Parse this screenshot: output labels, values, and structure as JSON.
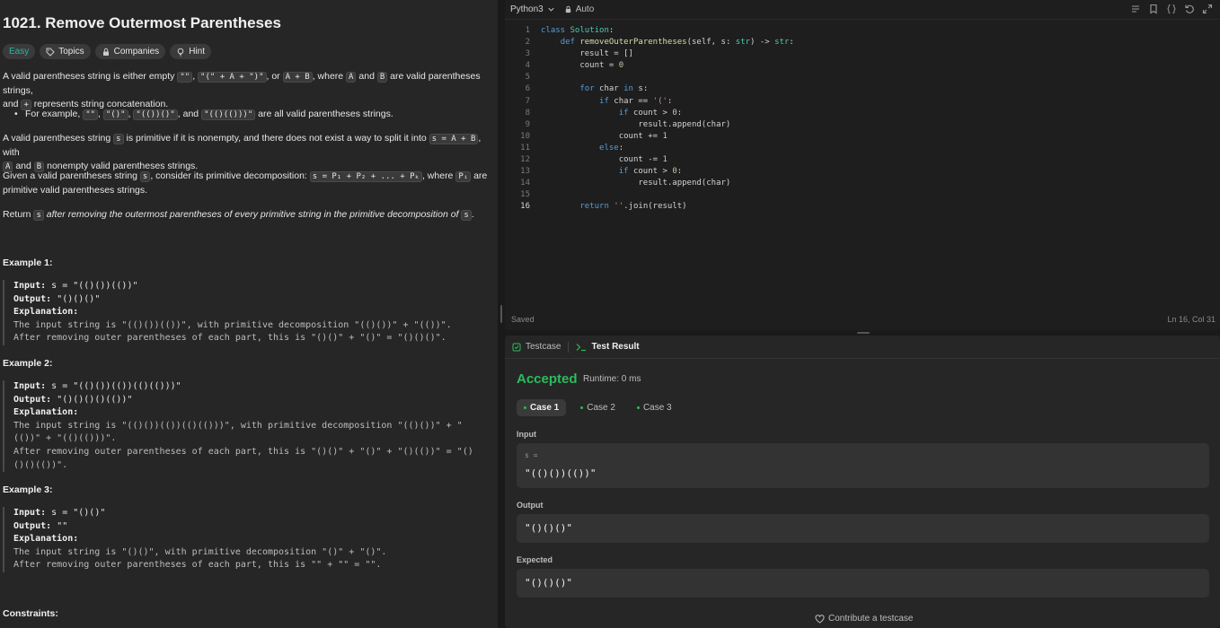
{
  "problem": {
    "title": "1021. Remove Outermost Parentheses",
    "difficulty": "Easy",
    "chips": [
      "Topics",
      "Companies",
      "Hint"
    ],
    "p1": {
      "t1": "A valid parentheses string is either empty ",
      "c1": "\"\"",
      "t2": ", ",
      "c2": "\"(\" + A + \")\"",
      "t3": ", or ",
      "c3": "A + B",
      "t4": ", where ",
      "c4": "A",
      "t5": " and ",
      "c5": "B",
      "t6": " are valid parentheses strings,",
      "t7": "and ",
      "c6": "+",
      "t8": " represents string concatenation."
    },
    "bullet": {
      "t1": "For example, ",
      "c1": "\"\"",
      "t2": ", ",
      "c2": "\"()\"",
      "t3": ", ",
      "c3": "\"(())()\"",
      "t4": ", and ",
      "c4": "\"(()(()))\"",
      "t5": " are all valid parentheses strings."
    },
    "p2": {
      "t1": "A valid parentheses string ",
      "c1": "s",
      "t2": " is primitive if it is nonempty, and there does not exist a way to split it into ",
      "c2": "s = A + B",
      "t3": ", with",
      "c3": "A",
      "t4": " and ",
      "c4": "B",
      "t5": " nonempty valid parentheses strings."
    },
    "p3": {
      "t1": "Given a valid parentheses string ",
      "c1": "s",
      "t2": ", consider its primitive decomposition: ",
      "c2": "s = P₁ + P₂ + ... + Pₖ",
      "t3": ", where ",
      "c3": "Pᵢ",
      "t4": " are",
      "t5": "primitive valid parentheses strings."
    },
    "p4": {
      "t1": "Return ",
      "c1": "s",
      "t2": " after removing the outermost parentheses of every primitive string in the primitive decomposition of ",
      "c2": "s",
      "t3": "."
    },
    "examples": [
      {
        "head": "Example 1:",
        "input_label": "Input:",
        "input": "s = \"(()())(())\"",
        "output_label": "Output:",
        "output": "\"()()()\"",
        "expl_label": "Explanation:",
        "lines": [
          "The input string is \"(()())(())\", with primitive decomposition \"(()())\" + \"(())\".",
          "After removing outer parentheses of each part, this is \"()()\" + \"()\" = \"()()()\"."
        ]
      },
      {
        "head": "Example 2:",
        "input_label": "Input:",
        "input": "s = \"(()())(())(()(()))\"",
        "output_label": "Output:",
        "output": "\"()()()()(())\"",
        "expl_label": "Explanation:",
        "lines": [
          "The input string is \"(()())(())(()(()))\", with primitive decomposition \"(()())\" + \"",
          "(())\" + \"(()(()))\".",
          "After removing outer parentheses of each part, this is \"()()\" + \"()\" + \"()(())\" = \"()",
          "()()(())\"."
        ]
      },
      {
        "head": "Example 3:",
        "input_label": "Input:",
        "input": "s = \"()()\"",
        "output_label": "Output:",
        "output": "\"\"",
        "expl_label": "Explanation:",
        "lines": [
          "The input string is \"()()\", with primitive decomposition \"()\" + \"()\".",
          "After removing outer parentheses of each part, this is \"\" + \"\" = \"\"."
        ]
      }
    ],
    "constraints_head": "Constraints:"
  },
  "editor": {
    "language": "Python3",
    "mode": "Auto",
    "status": "Saved",
    "cursor": "Ln 16, Col 31",
    "active_line": 16,
    "line_numbers": [
      "1",
      "2",
      "3",
      "4",
      "5",
      "6",
      "7",
      "8",
      "9",
      "10",
      "11",
      "12",
      "13",
      "14",
      "15",
      "16"
    ]
  },
  "result": {
    "tab_testcase": "Testcase",
    "tab_result": "Test Result",
    "verdict": "Accepted",
    "runtime": "Runtime: 0 ms",
    "cases": [
      "Case 1",
      "Case 2",
      "Case 3"
    ],
    "input_label": "Input",
    "input_var": "s =",
    "input_value": "\"(()())(())\"",
    "output_label": "Output",
    "output_value": "\"()()()\"",
    "expected_label": "Expected",
    "expected_value": "\"()()()\"",
    "contribute": "Contribute a testcase"
  },
  "colors": {
    "accepted": "#2cbb5d",
    "easy": "#2bb5a7",
    "keyword": "#569cd6"
  }
}
